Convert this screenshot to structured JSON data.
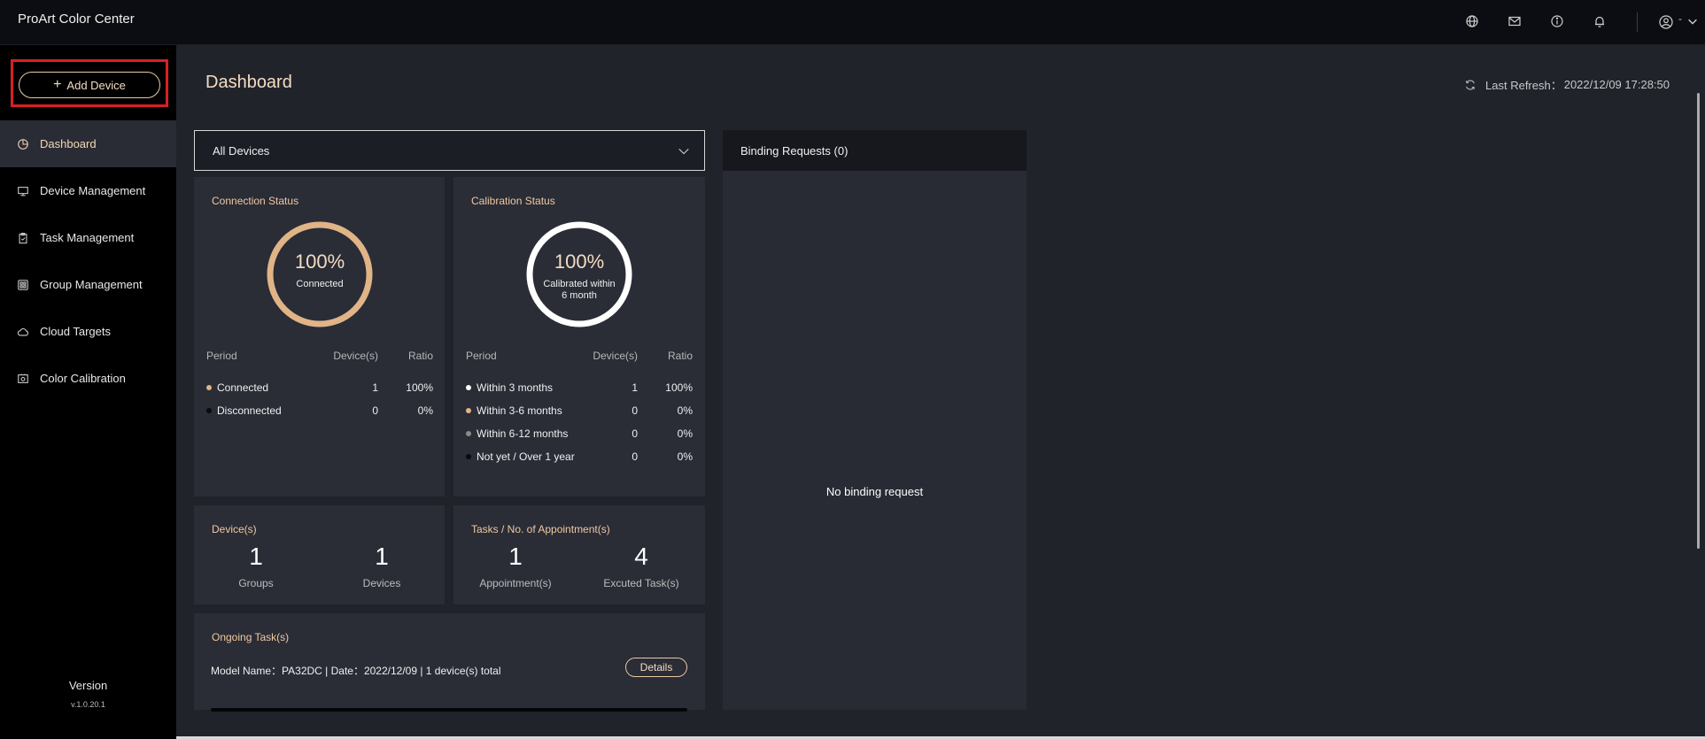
{
  "app": {
    "title": "ProArt Color Center"
  },
  "topbar": {
    "user_label": "-"
  },
  "sidebar": {
    "add_device_label": "Add Device",
    "items": [
      {
        "label": "Dashboard",
        "icon": "dashboard-icon",
        "active": true
      },
      {
        "label": "Device Management",
        "icon": "monitor-icon"
      },
      {
        "label": "Task Management",
        "icon": "clipboard-icon"
      },
      {
        "label": "Group Management",
        "icon": "group-icon"
      },
      {
        "label": "Cloud Targets",
        "icon": "cloud-icon"
      },
      {
        "label": "Color Calibration",
        "icon": "calibration-icon"
      }
    ],
    "version_label": "Version",
    "version_number": "v.1.0.20.1"
  },
  "header": {
    "title": "Dashboard",
    "last_refresh_label": "Last Refresh：",
    "last_refresh_value": "2022/12/09 17:28:50"
  },
  "device_filter": {
    "selected": "All Devices"
  },
  "connection_status": {
    "title": "Connection Status",
    "percent": "100%",
    "ring_label": "Connected",
    "ring_fraction": 1.0,
    "columns": [
      "Period",
      "Device(s)",
      "Ratio"
    ],
    "rows": [
      {
        "label": "Connected",
        "devices": "1",
        "ratio": "100%",
        "color": "#e0b487"
      },
      {
        "label": "Disconnected",
        "devices": "0",
        "ratio": "0%",
        "color": "#0a0a0a"
      }
    ]
  },
  "calibration_status": {
    "title": "Calibration Status",
    "percent": "100%",
    "ring_label_1": "Calibrated within",
    "ring_label_2": "6 month",
    "ring_fraction": 1.0,
    "columns": [
      "Period",
      "Device(s)",
      "Ratio"
    ],
    "rows": [
      {
        "label": "Within 3 months",
        "devices": "1",
        "ratio": "100%",
        "color": "#ffffff"
      },
      {
        "label": "Within 3-6 months",
        "devices": "0",
        "ratio": "0%",
        "color": "#e0b487"
      },
      {
        "label": "Within 6-12 months",
        "devices": "0",
        "ratio": "0%",
        "color": "#8a8a8a"
      },
      {
        "label": "Not yet / Over 1 year",
        "devices": "0",
        "ratio": "0%",
        "color": "#0a0a0a"
      }
    ]
  },
  "devices_card": {
    "title": "Device(s)",
    "groups_value": "1",
    "groups_label": "Groups",
    "devices_value": "1",
    "devices_label": "Devices"
  },
  "tasks_card": {
    "title": "Tasks / No. of Appointment(s)",
    "appointments_value": "1",
    "appointments_label": "Appointment(s)",
    "executed_value": "4",
    "executed_label": "Excuted Task(s)"
  },
  "ongoing": {
    "title": "Ongoing Task(s)",
    "task_text": "Model Name：PA32DC | Date：2022/12/09 | 1 device(s) total",
    "details_label": "Details"
  },
  "binding": {
    "title": "Binding Requests (0)",
    "empty_text": "No binding request"
  },
  "colors": {
    "accent": "#f3dcc0",
    "connection_ring": "#e0b487",
    "calibration_ring": "#ffffff",
    "highlight_box": "#d81f26"
  }
}
